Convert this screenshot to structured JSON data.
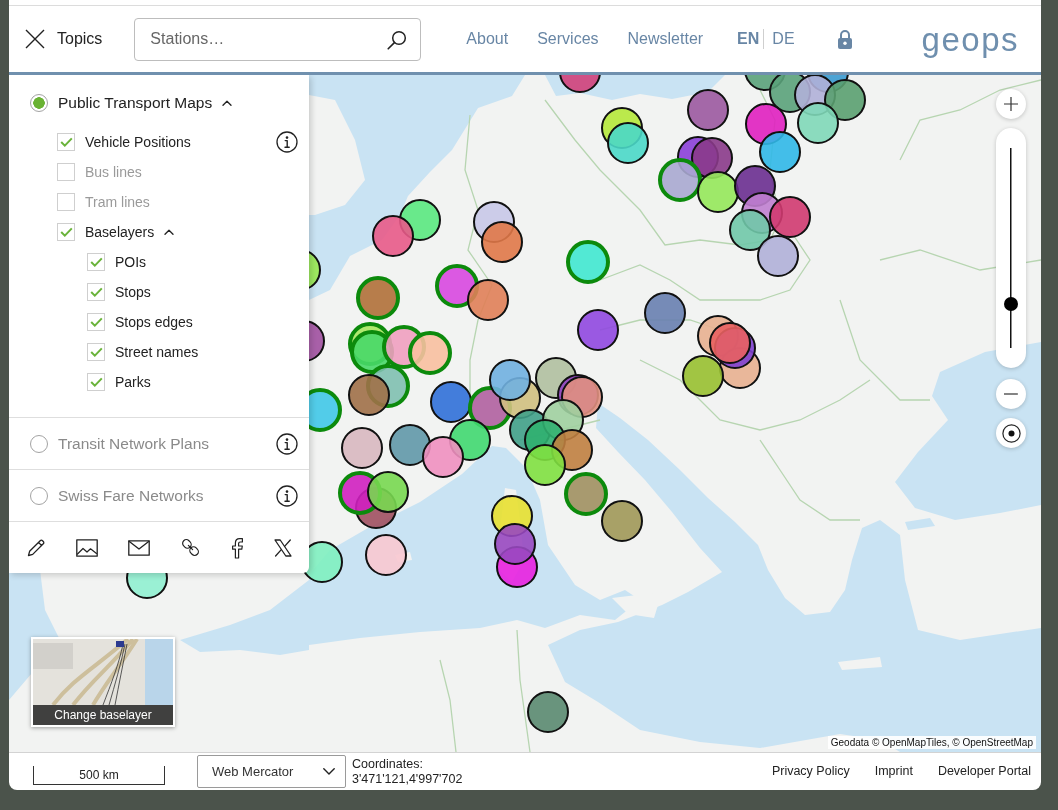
{
  "header": {
    "topics_button": "Topics",
    "search": {
      "placeholder": "Stations…"
    },
    "nav": [
      "About",
      "Services",
      "Newsletter"
    ],
    "languages": [
      {
        "label": "EN",
        "selected": true
      },
      {
        "label": "DE",
        "selected": false
      }
    ],
    "logo": "geops"
  },
  "topics": [
    {
      "label": "Public Transport Maps",
      "selected": true,
      "expanded": true,
      "info": false,
      "layers": [
        {
          "label": "Vehicle Positions",
          "checked": true,
          "info": true
        },
        {
          "label": "Bus lines",
          "checked": false,
          "info": false
        },
        {
          "label": "Tram lines",
          "checked": false,
          "info": false
        },
        {
          "label": "Baselayers",
          "checked": true,
          "info": false,
          "expanded": true,
          "children": [
            {
              "label": "POIs",
              "checked": true,
              "info": false
            },
            {
              "label": "Stops",
              "checked": true,
              "info": false
            },
            {
              "label": "Stops edges",
              "checked": true,
              "info": false
            },
            {
              "label": "Street names",
              "checked": true,
              "info": false
            },
            {
              "label": "Parks",
              "checked": true,
              "info": false
            }
          ]
        }
      ]
    },
    {
      "label": "Transit Network Plans",
      "selected": false,
      "info": true
    },
    {
      "label": "Swiss Fare Networks",
      "selected": false,
      "info": true
    }
  ],
  "map": {
    "zoom_slider": {
      "level": 0.2
    },
    "baselayer_button": "Change baselayer",
    "attribution": "Geodata © OpenMapTiles, © OpenStreetMap"
  },
  "footer": {
    "scale": "500 km",
    "projection": "Web Mercator",
    "coordinates_label": "Coordinates:",
    "coordinates": "3'471'121,4'997'702",
    "links": [
      "Privacy Policy",
      "Imprint",
      "Developer Portal"
    ]
  }
}
